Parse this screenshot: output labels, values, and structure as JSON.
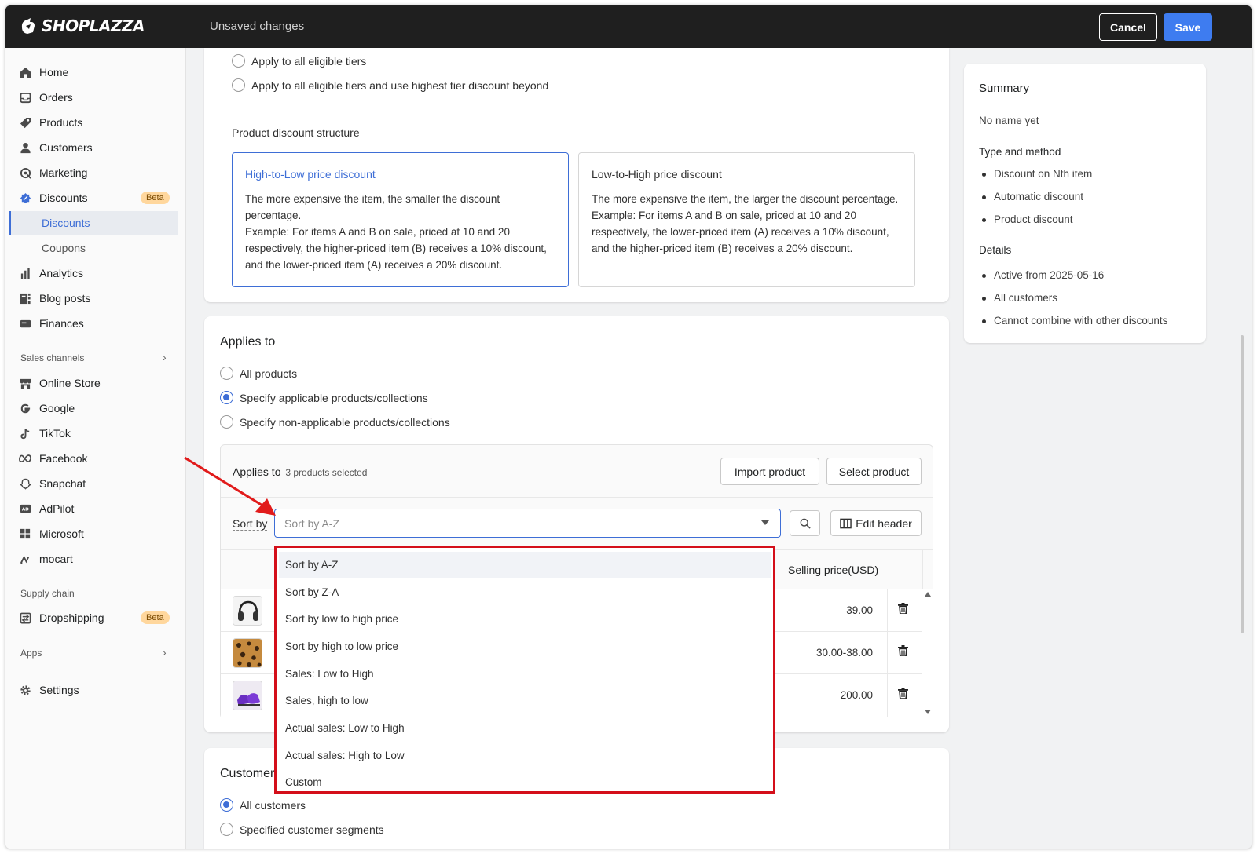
{
  "topbar": {
    "logo": "SHOPLAZZA",
    "status": "Unsaved changes",
    "cancel_label": "Cancel",
    "save_label": "Save"
  },
  "sidebar": {
    "items": [
      {
        "label": "Home",
        "icon": "home-icon"
      },
      {
        "label": "Orders",
        "icon": "inbox-icon"
      },
      {
        "label": "Products",
        "icon": "tag-icon"
      },
      {
        "label": "Customers",
        "icon": "person-icon"
      },
      {
        "label": "Marketing",
        "icon": "target-icon"
      },
      {
        "label": "Discounts",
        "icon": "discount-icon",
        "badge": "Beta"
      },
      {
        "label": "Discounts",
        "sub": true,
        "active": true
      },
      {
        "label": "Coupons",
        "sub": true
      },
      {
        "label": "Analytics",
        "icon": "bar-chart-icon"
      },
      {
        "label": "Blog posts",
        "icon": "blog-icon"
      },
      {
        "label": "Finances",
        "icon": "finance-icon"
      }
    ],
    "sales_channels_label": "Sales channels",
    "channels": [
      {
        "label": "Online Store",
        "icon": "store-icon"
      },
      {
        "label": "Google",
        "icon": "google-icon"
      },
      {
        "label": "TikTok",
        "icon": "tiktok-icon"
      },
      {
        "label": "Facebook",
        "icon": "meta-icon"
      },
      {
        "label": "Snapchat",
        "icon": "snapchat-icon"
      },
      {
        "label": "AdPilot",
        "icon": "adpilot-icon"
      },
      {
        "label": "Microsoft",
        "icon": "microsoft-icon"
      },
      {
        "label": "mocart",
        "icon": "mocart-icon"
      }
    ],
    "supply_chain_label": "Supply chain",
    "dropshipping": {
      "label": "Dropshipping",
      "icon": "dropshipping-icon",
      "badge": "Beta"
    },
    "apps_label": "Apps",
    "settings_label": "Settings"
  },
  "tiers": {
    "options": [
      "Apply to all eligible tiers",
      "Apply to all eligible tiers and use highest tier discount beyond"
    ]
  },
  "structure": {
    "label": "Product discount structure",
    "high_to_low": {
      "title": "High-to-Low price discount",
      "desc": "The more expensive the item, the smaller the discount percentage.",
      "example": "Example: For items A and B on sale, priced at 10 and 20 respectively, the higher-priced item (B) receives a 10% discount, and the lower-priced item (A) receives a 20% discount."
    },
    "low_to_high": {
      "title": "Low-to-High price discount",
      "desc": "The more expensive the item, the larger the discount percentage.",
      "example": "Example: For items A and B on sale, priced at 10 and 20 respectively, the lower-priced item (A) receives a 10% discount, and the higher-priced item (B) receives a 20% discount."
    }
  },
  "applies": {
    "title": "Applies to",
    "options": [
      "All products",
      "Specify applicable products/collections",
      "Specify non-applicable products/collections"
    ],
    "selected_index": 1,
    "panel_title": "Applies to",
    "panel_count": "3 products selected",
    "import_label": "Import product",
    "select_label": "Select product",
    "sort_label": "Sort by",
    "sort_placeholder": "Sort by A-Z",
    "edit_header_label": "Edit header",
    "col_price": "Selling price(USD)",
    "rows": [
      {
        "thumb": "headphones",
        "price": "39.00"
      },
      {
        "thumb": "leopard-print",
        "price": "30.00-38.00"
      },
      {
        "thumb": "purple-shoes",
        "price": "200.00"
      }
    ]
  },
  "sort_options": [
    "Sort by A-Z",
    "Sort by Z-A",
    "Sort by low to high price",
    "Sort by high to low price",
    "Sales: Low to High",
    "Sales, high to low",
    "Actual sales: Low to High",
    "Actual sales: High to Low",
    "Custom"
  ],
  "customer": {
    "title": "Customer",
    "options": [
      "All customers",
      "Specified customer segments"
    ]
  },
  "summary": {
    "title": "Summary",
    "name": "No name yet",
    "type_heading": "Type and method",
    "type_items": [
      "Discount on Nth item",
      "Automatic discount",
      "Product discount"
    ],
    "details_heading": "Details",
    "details_items": [
      "Active from 2025-05-16",
      "All customers",
      "Cannot combine with other discounts"
    ]
  },
  "colors": {
    "accent": "#3e6ed6",
    "topbar": "#1f1f1f",
    "save": "#3e7cf0",
    "highlight": "#d40f1a",
    "beta_bg": "#ffd79d"
  }
}
